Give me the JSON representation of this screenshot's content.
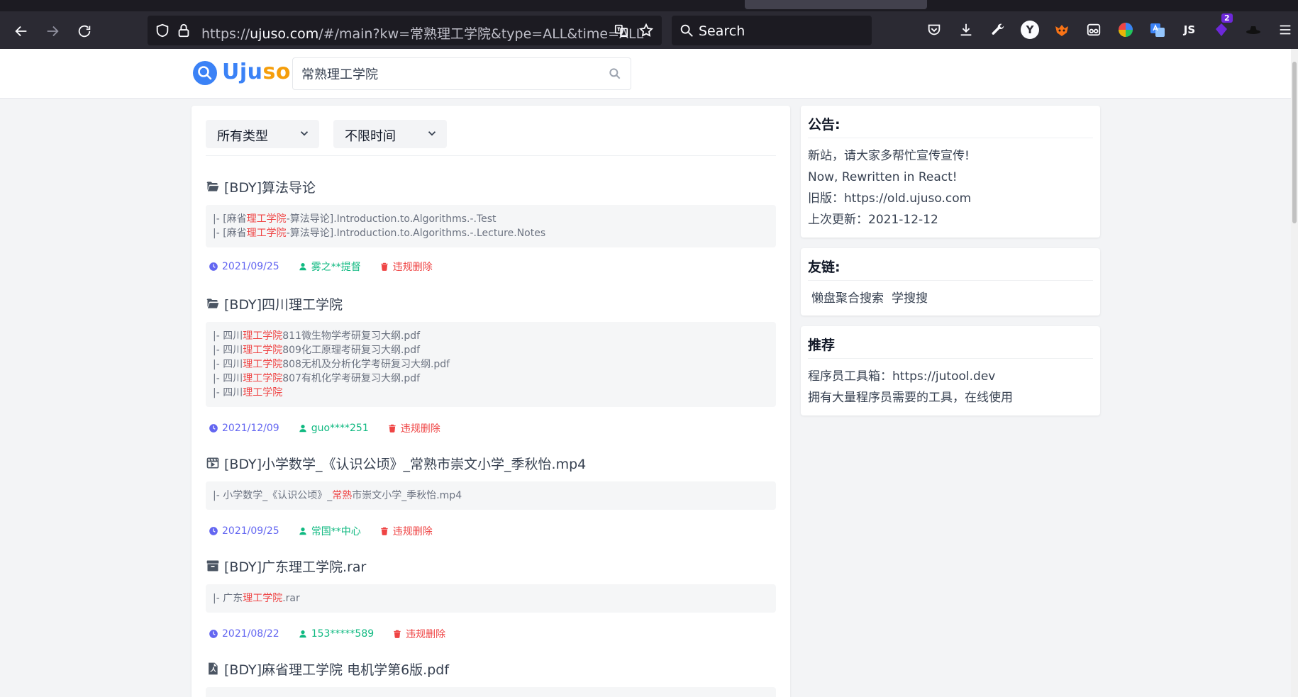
{
  "browser": {
    "url_prefix": "https://",
    "url_domain": "ujuso.com",
    "url_path": "/#/main?kw=常熟理工学院&type=ALL&time=ALL",
    "search_placeholder": "Search",
    "extension_badge": "2",
    "ext_js_label": "JS",
    "ext_y_label": "Y"
  },
  "header": {
    "logo_u": "Uju",
    "logo_so": "so",
    "search_value": "常熟理工学院"
  },
  "filters": {
    "type": "所有类型",
    "time": "不限时间"
  },
  "results": [
    {
      "title": "[BDY]算法导论",
      "icon": "folder-open-icon",
      "files": [
        {
          "pre": "|- [麻省",
          "hl": "理工学院",
          "post": "-算法导论].Introduction.to.Algorithms.-.Test"
        },
        {
          "pre": "|- [麻省",
          "hl": "理工学院",
          "post": "-算法导论].Introduction.to.Algorithms.-.Lecture.Notes"
        }
      ],
      "date": "2021/09/25",
      "user": "雾之**提督",
      "report": "违规删除"
    },
    {
      "title": "[BDY]四川理工学院",
      "icon": "folder-open-icon",
      "files": [
        {
          "pre": "|- 四川",
          "hl": "理工学院",
          "post": "811微生物学考研复习大纲.pdf"
        },
        {
          "pre": "|- 四川",
          "hl": "理工学院",
          "post": "809化工原理考研复习大纲.pdf"
        },
        {
          "pre": "|- 四川",
          "hl": "理工学院",
          "post": "808无机及分析化学考研复习大纲.pdf"
        },
        {
          "pre": "|- 四川",
          "hl": "理工学院",
          "post": "807有机化学考研复习大纲.pdf"
        },
        {
          "pre": "|- 四川",
          "hl": "理工学院",
          "post": ""
        }
      ],
      "date": "2021/12/09",
      "user": "guo****251",
      "report": "违规删除"
    },
    {
      "title": "[BDY]小学数学_《认识公顷》_常熟市崇文小学_季秋怡.mp4",
      "icon": "video-file-icon",
      "files": [
        {
          "pre": "|- 小学数学_《认识公顷》_",
          "hl": "常熟",
          "post": "市崇文小学_季秋怡.mp4"
        }
      ],
      "date": "2021/09/25",
      "user": "常国**中心",
      "report": "违规删除"
    },
    {
      "title": "[BDY]广东理工学院.rar",
      "icon": "archive-icon",
      "files": [
        {
          "pre": "|- 广东",
          "hl": "理工学院",
          "post": ".rar"
        }
      ],
      "date": "2021/08/22",
      "user": "153*****589",
      "report": "违规删除"
    },
    {
      "title": "[BDY]麻省理工学院 电机学第6版.pdf",
      "icon": "pdf-file-icon",
      "files": [],
      "date": "",
      "user": "",
      "report": ""
    }
  ],
  "sidebar": {
    "announcement": {
      "title": "公告:",
      "lines": [
        "新站，请大家多帮忙宣传宣传!",
        "Now, Rewritten in React!",
        "旧版：https://old.ujuso.com",
        "上次更新：2021-12-12"
      ]
    },
    "links": {
      "title": "友链:",
      "items": [
        "懒盘聚合搜索",
        "学搜搜"
      ]
    },
    "recommend": {
      "title": "推荐",
      "lines": [
        "程序员工具箱：https://jutool.dev",
        "拥有大量程序员需要的工具，在线使用"
      ]
    }
  },
  "colors": {
    "accent": "#3b82f6",
    "highlight": "#ef4444",
    "date": "#6366f1",
    "user": "#10b981"
  }
}
